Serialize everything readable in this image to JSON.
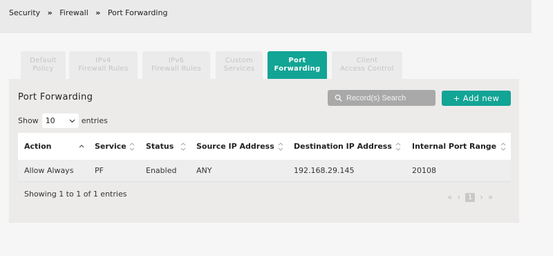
{
  "breadcrumb": {
    "items": [
      "Security",
      "Firewall",
      "Port Forwarding"
    ],
    "separator": "»"
  },
  "tabs": [
    {
      "line1": "Default",
      "line2": "Policy",
      "active": false
    },
    {
      "line1": "IPv4",
      "line2": "Firewall Rules",
      "active": false
    },
    {
      "line1": "IPv6",
      "line2": "Firewall Rules",
      "active": false
    },
    {
      "line1": "Custom",
      "line2": "Services",
      "active": false
    },
    {
      "line1": "Port",
      "line2": "Forwarding",
      "active": true
    },
    {
      "line1": "Client",
      "line2": "Access Control",
      "active": false
    }
  ],
  "panel": {
    "title": "Port Forwarding",
    "search_placeholder": "Record(s) Search",
    "search_icon": "search-icon",
    "add_button": "+ Add new",
    "show_label": "Show",
    "entries_value": "10",
    "entries_label": "entries"
  },
  "table": {
    "columns": [
      "Action",
      "Service",
      "Status",
      "Source IP Address",
      "Destination IP Address",
      "Internal Port Range"
    ],
    "rows": [
      [
        "Allow Always",
        "PF",
        "Enabled",
        "ANY",
        "192.168.29.145",
        "20108"
      ]
    ]
  },
  "footer": {
    "info": "Showing 1 to 1 of 1 entries",
    "current_page": "1"
  },
  "colors": {
    "accent": "#12a495",
    "panel": "#ecebea",
    "header_bar": "#eaeaea"
  }
}
